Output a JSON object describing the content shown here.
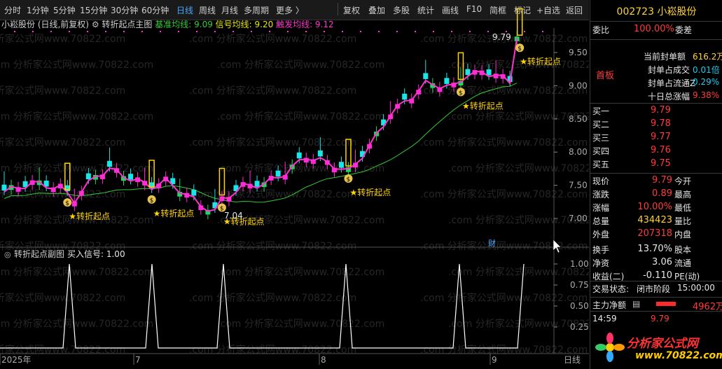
{
  "toolbar": {
    "tabs": [
      "分时",
      "1分钟",
      "5分钟",
      "15分钟",
      "30分钟",
      "60分钟",
      "日线",
      "周线",
      "月线",
      "多周期",
      "更多 〉"
    ],
    "active_tab": "日线",
    "tools": [
      "复权",
      "叠加",
      "多股",
      "统计",
      "画线",
      "F10",
      "简框",
      "标记",
      "+自选",
      "返回"
    ]
  },
  "main_chart": {
    "stock_label": "小崧股份 (日线,前复权)",
    "indicator_name": "转折起点主图",
    "base_label": "基准均线: 9.09",
    "signal_label": "信号均线: 9.20",
    "trigger_label": "触发均线: 9.12",
    "y_ticks": [
      "9.50",
      "9.00",
      "8.50",
      "8.00",
      "7.50",
      "7.00"
    ],
    "high_label": "9.79",
    "low_label": "7.04",
    "signal_text": "★转折起点",
    "cai_label": "财"
  },
  "sub_chart": {
    "indicator_name": "转折起点副图",
    "value_label": "买入信号: 1.00",
    "y_ticks": [
      "1.00",
      "0.75",
      "0.50",
      "0.25"
    ]
  },
  "x_axis": {
    "labels": [
      "2025年",
      "7",
      "8",
      "9",
      "日线"
    ]
  },
  "watermark": ".com 分析家公式网www.70822.com",
  "right_panel": {
    "code_name": "002723 小崧股份",
    "weibi_label": "委比",
    "weibi_value": "100.00%",
    "weicha_label": "委差",
    "board": "首板",
    "fd_amount_label": "当前封单额",
    "fd_amount_value": "616.2万",
    "fd_deal_label": "封单占成交",
    "fd_deal_value": "0.01倍",
    "fd_float_label": "封单占流通Z",
    "fd_float_value": "0.29%",
    "ten_day_label": "十日总涨幅",
    "ten_day_value": "9.38%",
    "bids": [
      {
        "label": "买一",
        "price": "9.79"
      },
      {
        "label": "买二",
        "price": "9.78"
      },
      {
        "label": "买三",
        "price": "9.77"
      },
      {
        "label": "买四",
        "price": "9.76"
      },
      {
        "label": "买五",
        "price": "9.75"
      }
    ],
    "quote": {
      "price_label": "现价",
      "price": "9.79",
      "open_label": "今开",
      "chg_label": "涨跌",
      "chg": "0.89",
      "high_label": "最高",
      "pct_label": "涨幅",
      "pct": "10.00%",
      "low_label": "最低",
      "vol_label": "总量",
      "vol": "434423",
      "vr_label": "量比",
      "outer_label": "外盘",
      "outer": "207318",
      "inner_label": "内盘",
      "turnover_label": "换手",
      "turnover": "13.70%",
      "equity_label": "股本",
      "nav_label": "净资",
      "nav": "3.06",
      "float_label": "流通",
      "eps_label": "收益(二)",
      "eps": "-0.110",
      "pe_label": "PE(动)"
    },
    "trade_state_label": "交易状态:",
    "trade_state": "闭市阶段",
    "trade_time": "15:00:00",
    "main_net_label": "主力净额",
    "main_net_value": "4962万",
    "ticks": [
      {
        "time": "14:59",
        "price": "9.79"
      }
    ],
    "logo_text": "分析家公式网",
    "logo_url": "www.70822.com"
  },
  "colors": {
    "up": "#ff2ad8",
    "down": "#19e6e6",
    "up_green": "#1ed760",
    "ma": "#33cc33",
    "signal": "#ffd400",
    "bg": "#000000"
  }
}
